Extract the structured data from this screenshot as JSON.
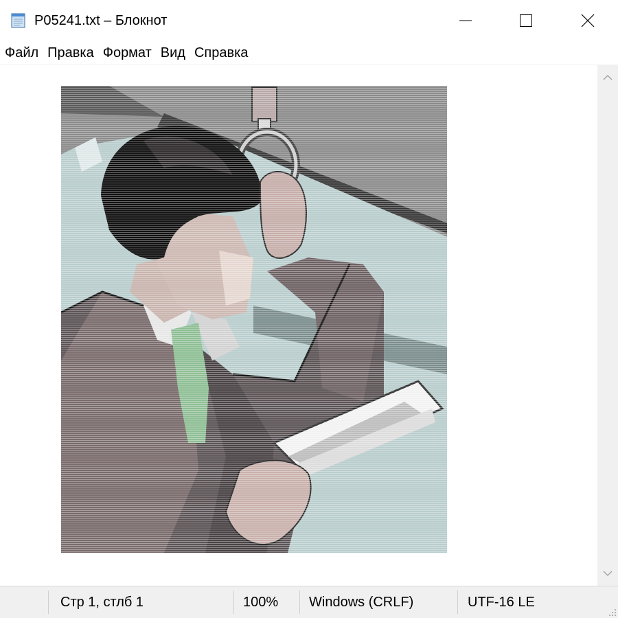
{
  "window": {
    "title": "P05241.txt – Блокнот"
  },
  "icons": {
    "app": "notepad-icon",
    "minimize": "minimize-icon",
    "maximize": "maximize-icon",
    "close": "close-icon",
    "scroll_up": "chevron-up-icon",
    "scroll_down": "chevron-down-icon",
    "grip": "resize-grip-icon"
  },
  "menu": {
    "items": [
      "Файл",
      "Правка",
      "Формат",
      "Вид",
      "Справка"
    ]
  },
  "status": {
    "position": "Стр 1, стлб 1",
    "zoom": "100%",
    "line_ending": "Windows (CRLF)",
    "encoding": "UTF-16 LE"
  },
  "colors": {
    "chrome": "#f0f0f0",
    "art_gray": "#8a8a8a",
    "art_teal": "#b8cccc",
    "art_skin": "#c9b4ae",
    "art_tie": "#8fbf95",
    "art_suit": "#5e5658"
  }
}
